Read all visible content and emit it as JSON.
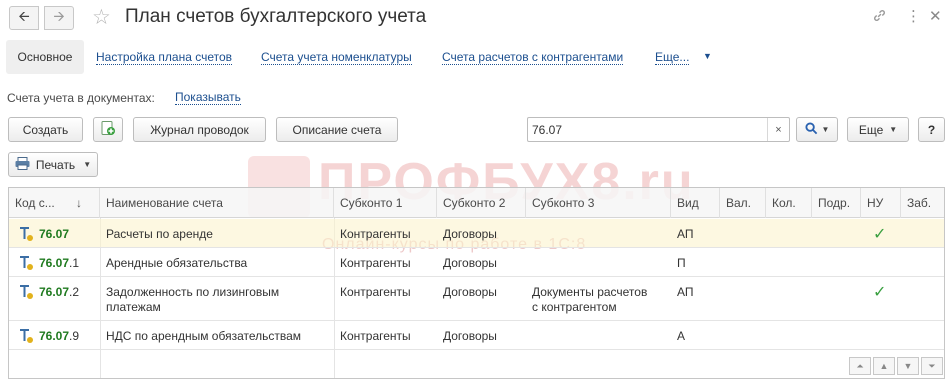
{
  "header": {
    "title": "План счетов бухгалтерского учета",
    "back_icon": "arrow-left-icon",
    "forward_icon": "arrow-right-icon",
    "favorite_icon": "star-icon",
    "link_icon": "link-icon",
    "more_icon": "more-vertical-icon",
    "close_icon": "close-icon"
  },
  "tabs": {
    "main": "Основное",
    "links": [
      "Настройка плана счетов",
      "Счета учета номенклатуры",
      "Счета расчетов с контрагентами",
      "Еще..."
    ]
  },
  "doc_accounts": {
    "label": "Счета учета в документах:",
    "link": "Показывать"
  },
  "toolbar": {
    "create": "Создать",
    "journal": "Журнал проводок",
    "description": "Описание счета",
    "more": "Еще",
    "help": "?",
    "print": "Печать"
  },
  "search": {
    "value": "76.07",
    "clear": "×"
  },
  "watermark": {
    "text": "ПРОФБУХ8.ru",
    "sub": "Онлайн-курсы по работе в 1С:8"
  },
  "table": {
    "columns": [
      "Код с...",
      "Наименование счета",
      "Субконто 1",
      "Субконто 2",
      "Субконто 3",
      "Вид",
      "Вал.",
      "Кол.",
      "Подр.",
      "НУ",
      "Заб."
    ],
    "sort_icon": "↓",
    "rows": [
      {
        "code_bold": "76.07",
        "code_rest": "",
        "name": "Расчеты по аренде",
        "name2": "",
        "sub1": "Контрагенты",
        "sub2": "Договоры",
        "sub3": "",
        "sub3b": "",
        "kind": "АП",
        "nu": true
      },
      {
        "code_bold": "76.07",
        "code_rest": ".1",
        "name": "Арендные обязательства",
        "name2": "",
        "sub1": "Контрагенты",
        "sub2": "Договоры",
        "sub3": "",
        "sub3b": "",
        "kind": "П",
        "nu": false
      },
      {
        "code_bold": "76.07",
        "code_rest": ".2",
        "name": "Задолженность по лизинговым",
        "name2": "платежам",
        "sub1": "Контрагенты",
        "sub2": "Договоры",
        "sub3": "Документы расчетов",
        "sub3b": "с контрагентом",
        "kind": "АП",
        "nu": true
      },
      {
        "code_bold": "76.07",
        "code_rest": ".9",
        "name": "НДС по арендным обязательствам",
        "name2": "",
        "sub1": "Контрагенты",
        "sub2": "Договоры",
        "sub3": "",
        "sub3b": "",
        "kind": "А",
        "nu": false
      }
    ]
  },
  "colors": {
    "link": "#1c4f8f",
    "code_green": "#1f7a1f",
    "check_green": "#3aa040",
    "selected_row": "#fcf3cd"
  }
}
